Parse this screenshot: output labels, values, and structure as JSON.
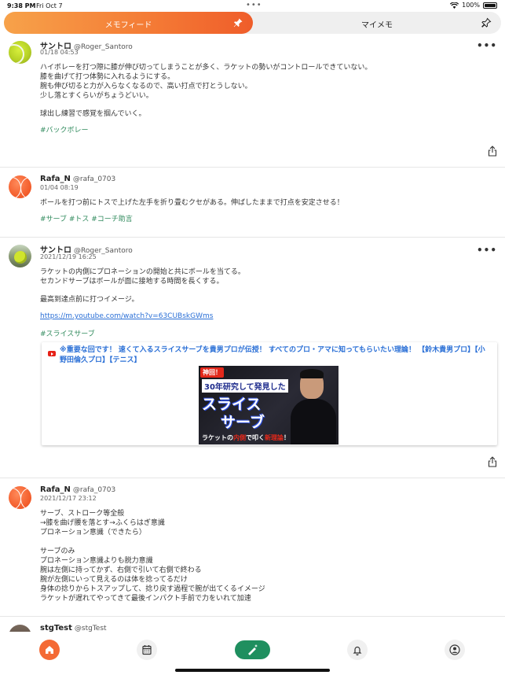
{
  "status": {
    "time": "9:38 PM",
    "date": "Fri Oct 7",
    "battery": "100%"
  },
  "tabs": {
    "active_label": "メモフィード",
    "inactive_label": "マイメモ"
  },
  "posts": [
    {
      "name": "サントロ",
      "handle": "@Roger_Santoro",
      "datetime": "01/18 04:53",
      "lines": [
        "ハイボレーを打つ際に膝が伸び切ってしまうことが多く、ラケットの勢いがコントロールできていない。",
        "膝を曲げて打つ体勢に入れるようにする。",
        "腕も伸び切ると力が入らなくなるので、高い打点で打とうしない。",
        "少し落とすくらいがちょうどいい。",
        "球出し練習で感覚を掴んでいく。"
      ],
      "tags": "#バックボレー"
    },
    {
      "name": "Rafa_N",
      "handle": "@rafa_0703",
      "datetime": "01/04 08:19",
      "lines": [
        "ボールを打つ前にトスで上げた左手を折り畳むクセがある。伸ばしたままで打点を安定させる！"
      ],
      "tags": "#サーブ #トス #コーチ助言"
    },
    {
      "name": "サントロ",
      "handle": "@Roger_Santoro",
      "datetime": "2021/12/19 16:25",
      "lines": [
        "ラケットの内側にプロネーションの開始と共にボールを当てる。",
        "セカンドサーブはボールが面に接地する時間を長くする。",
        "最高到達点前に打つイメージ。"
      ],
      "link": "https://m.youtube.com/watch?v=63CUBskGWms",
      "tags": "#スライスサーブ",
      "preview": {
        "title": "※重要な回です！ 速くて入るスライスサーブを貴男プロが伝授！ すべてのプロ・アマに知ってもらいたい理論！ 【鈴木貴男プロ】【小野田倫久プロ】【テニス】",
        "thumb_badge": "神回！",
        "thumb_line1": "30年研究して発見した",
        "thumb_big1": "スライス",
        "thumb_big2": "サーブ",
        "thumb_bottom_a": "ラケットの",
        "thumb_bottom_b": "内側",
        "thumb_bottom_c": "で叩く",
        "thumb_bottom_d": "新理論",
        "thumb_bottom_e": "！"
      }
    },
    {
      "name": "Rafa_N",
      "handle": "@rafa_0703",
      "datetime": "2021/12/17 23:12",
      "lines": [
        "サーブ、ストローク等全般",
        "→膝を曲げ腰を落とす→ふくらはぎ意識",
        "プロネーション意識（できたら）",
        "サーブのみ",
        "プロネーション意識よりも脱力意識",
        "腕は左側に持ってかず、右側で引いて右側で終わる",
        "腕が左側にいって見えるのは体を捻ってるだけ",
        "身体の捻りからトスアップして、捻り戻す過程で腕が出てくるイメージ",
        "ラケットが遅れてやってきて最後インパクト手前で力をいれて加速"
      ]
    },
    {
      "name": "stgTest",
      "handle": "@stgTest"
    }
  ]
}
